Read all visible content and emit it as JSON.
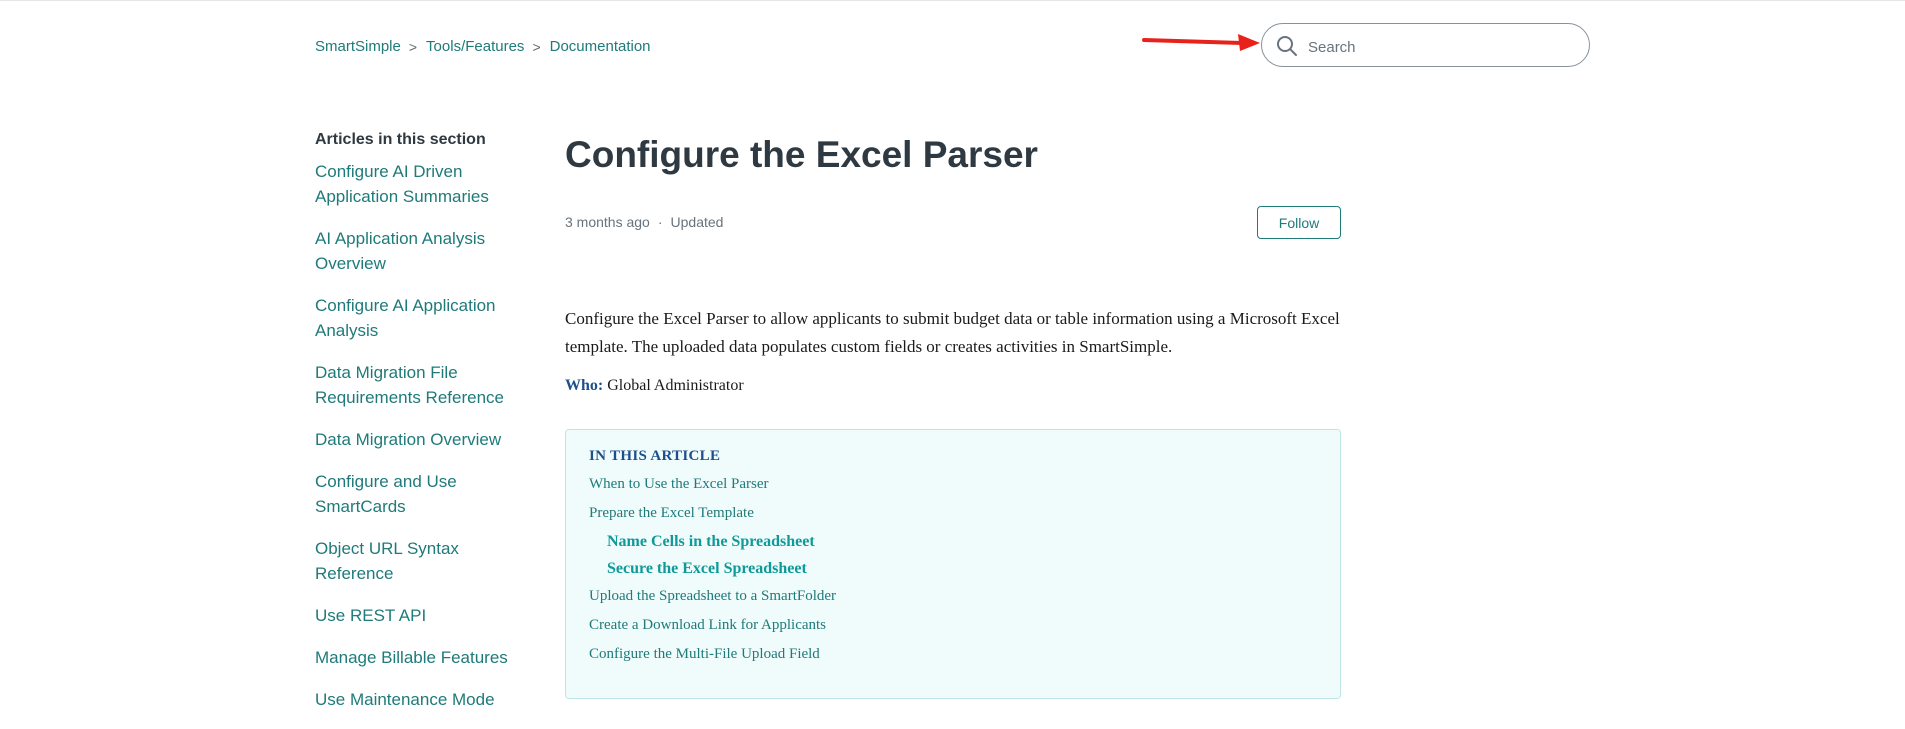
{
  "breadcrumb": {
    "items": [
      "SmartSimple",
      "Tools/Features",
      "Documentation"
    ],
    "separator": ">"
  },
  "search": {
    "placeholder": "Search",
    "value": ""
  },
  "annotation": {
    "arrow_color": "#e8221b"
  },
  "sidebar": {
    "heading": "Articles in this section",
    "items": [
      "Configure AI Driven Application Summaries",
      "AI Application Analysis Overview",
      "Configure AI Application Analysis",
      "Data Migration File Requirements Reference",
      "Data Migration Overview",
      "Configure and Use SmartCards",
      "Object URL Syntax Reference",
      "Use REST API",
      "Manage Billable Features",
      "Use Maintenance Mode"
    ]
  },
  "article": {
    "title": "Configure the Excel Parser",
    "meta_time": "3 months ago",
    "meta_dot": "·",
    "meta_updated": "Updated",
    "follow_label": "Follow",
    "intro": "Configure the Excel Parser to allow applicants to submit budget data or table information using a Microsoft Excel template. The uploaded data populates custom fields or creates activities in SmartSimple.",
    "who_label": "Who:",
    "who_value": " Global Administrator"
  },
  "toc": {
    "heading": "IN THIS ARTICLE",
    "items": [
      "When to Use the Excel Parser",
      "Prepare the Excel Template",
      "Name Cells in the Spreadsheet",
      "Secure the Excel Spreadsheet",
      "Upload the Spreadsheet to a SmartFolder",
      "Create a Download Link for Applicants",
      "Configure the Multi-File Upload Field"
    ]
  },
  "colors": {
    "link": "#1f7a7a",
    "title": "#2f3941",
    "toc_background": "#f0fbfb",
    "who_label": "#1e4f8a"
  },
  "icons": {
    "search": "magnifier-icon"
  }
}
